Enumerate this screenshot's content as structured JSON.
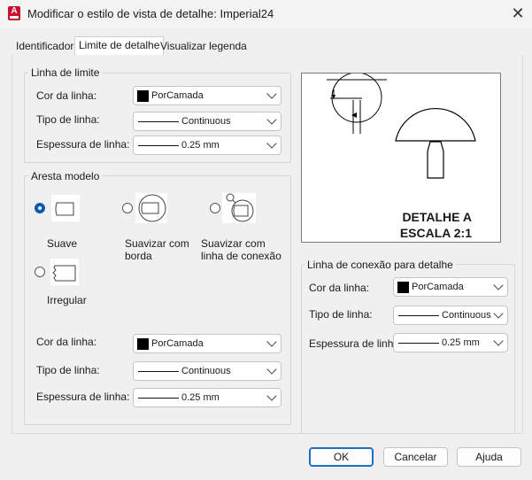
{
  "window": {
    "app_icon_letter": "A",
    "title": "Modificar o estilo de vista de detalhe: Imperial24",
    "close_glyph": "✕"
  },
  "tabs": [
    {
      "label": "Identificador"
    },
    {
      "label": "Limite de detalhe"
    },
    {
      "label": "Visualizar legenda"
    }
  ],
  "boundary": {
    "group_title": "Linha de limite",
    "color_label": "Cor da linha:",
    "color_value": "PorCamada",
    "linetype_label": "Tipo de linha:",
    "linetype_value": "Continuous",
    "weight_label": "Espessura de linha:",
    "weight_value": "0.25 mm"
  },
  "model_edge": {
    "group_title": "Aresta modelo",
    "options": [
      {
        "label": "Suave"
      },
      {
        "label": "Suavizar com borda"
      },
      {
        "label": "Suavizar com linha de conexão"
      },
      {
        "label": "Irregular"
      }
    ],
    "selected": "Suave",
    "color_label": "Cor da linha:",
    "color_value": "PorCamada",
    "linetype_label": "Tipo de linha:",
    "linetype_value": "Continuous",
    "weight_label": "Espessura de linha:",
    "weight_value": "0.25 mm"
  },
  "preview": {
    "line1": "DETALHE A",
    "line2": "ESCALA 2:1"
  },
  "connection": {
    "group_title": "Linha de conexão para detalhe",
    "color_label": "Cor da linha:",
    "color_value": "PorCamada",
    "linetype_label": "Tipo de linha:",
    "linetype_value": "Continuous",
    "weight_label": "Espessura de linha:",
    "weight_value": "0.25 mm"
  },
  "buttons": {
    "ok": "OK",
    "cancel": "Cancelar",
    "help": "Ajuda"
  },
  "colors": {
    "accent": "#0b5cad",
    "app_icon": "#c8102e"
  }
}
